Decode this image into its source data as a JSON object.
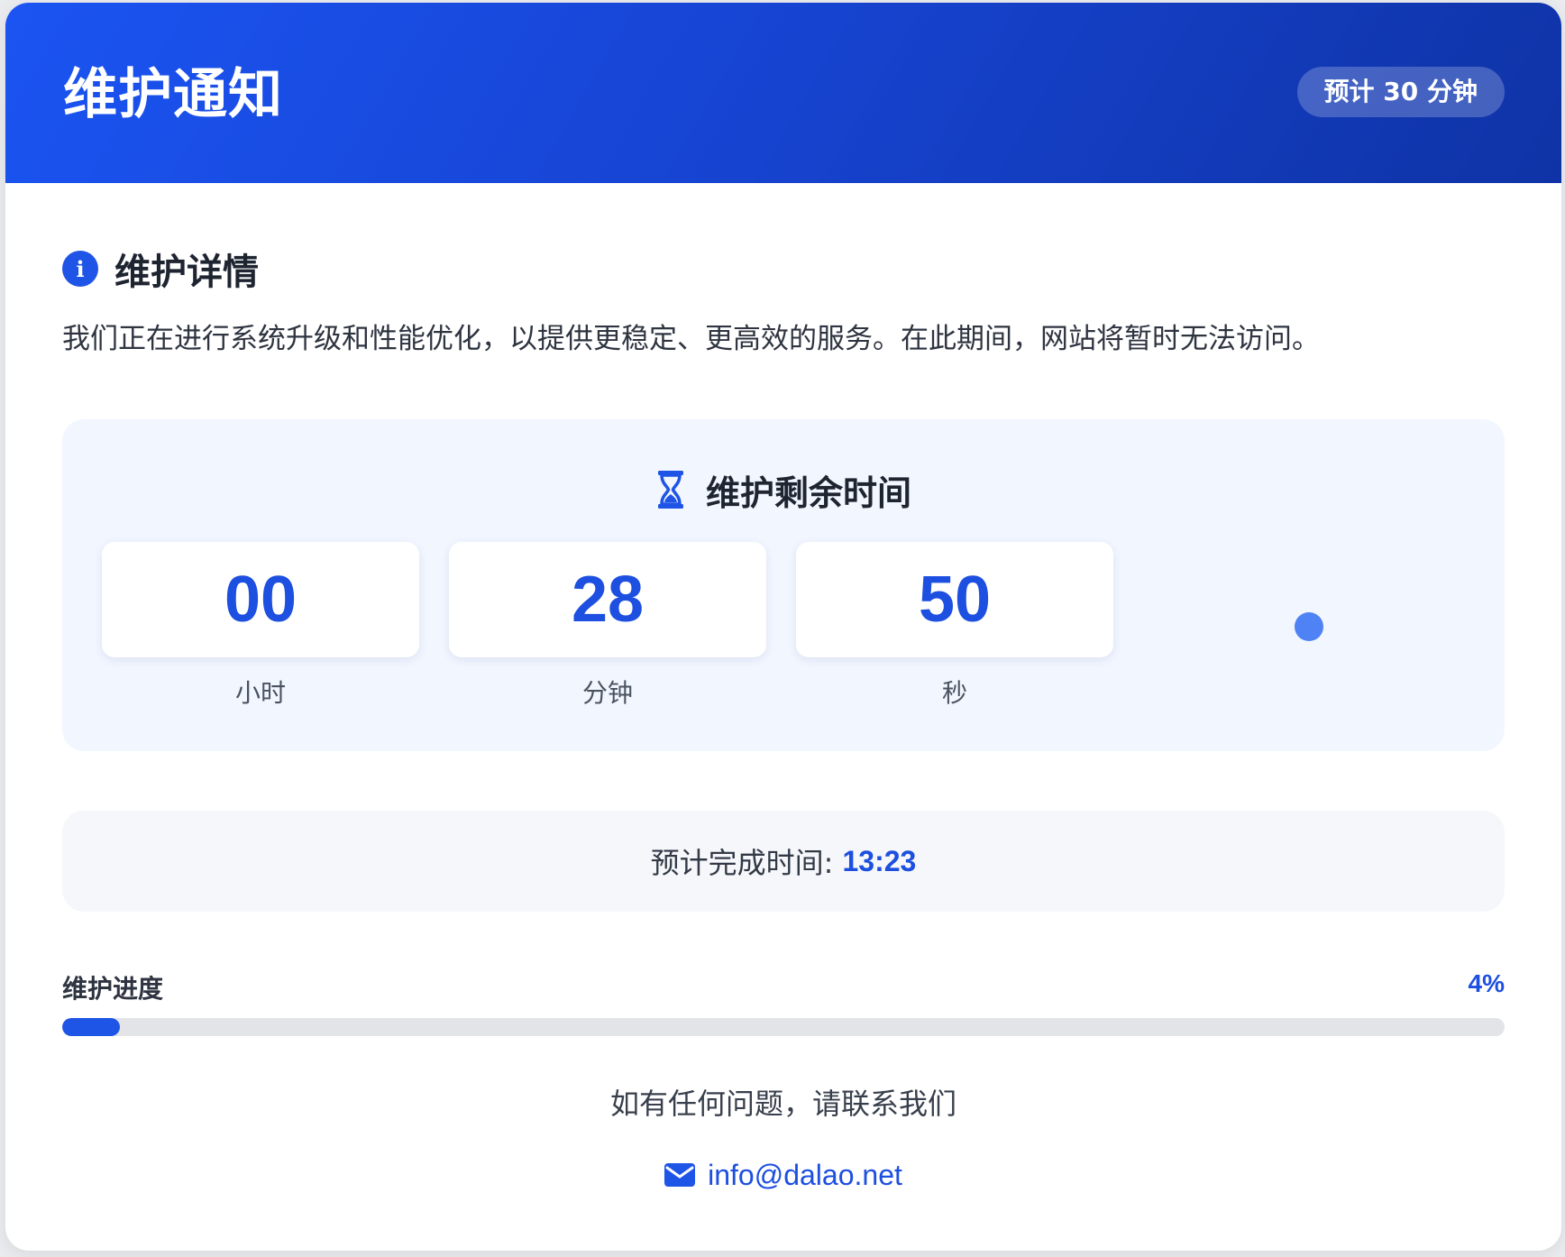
{
  "header": {
    "title": "维护通知",
    "badge": "预计 30 分钟"
  },
  "details": {
    "icon": "info-icon",
    "title": "维护详情",
    "description": "我们正在进行系统升级和性能优化，以提供更稳定、更高效的服务。在此期间，网站将暂时无法访问。"
  },
  "countdown": {
    "icon": "hourglass-icon",
    "title": "维护剩余时间",
    "units": [
      {
        "value": "00",
        "label": "小时"
      },
      {
        "value": "28",
        "label": "分钟"
      },
      {
        "value": "50",
        "label": "秒"
      }
    ]
  },
  "eta": {
    "label": "预计完成时间:",
    "time": "13:23"
  },
  "progress": {
    "label": "维护进度",
    "percent_text": "4%",
    "fraction": 0.04
  },
  "contact": {
    "text": "如有任何问题，请联系我们",
    "icon": "mail-icon",
    "email": "info@dalao.net"
  },
  "colors": {
    "accent": "#1d4fe0",
    "header_gradient_start": "#1b54f2",
    "header_gradient_end": "#0f33a6"
  }
}
